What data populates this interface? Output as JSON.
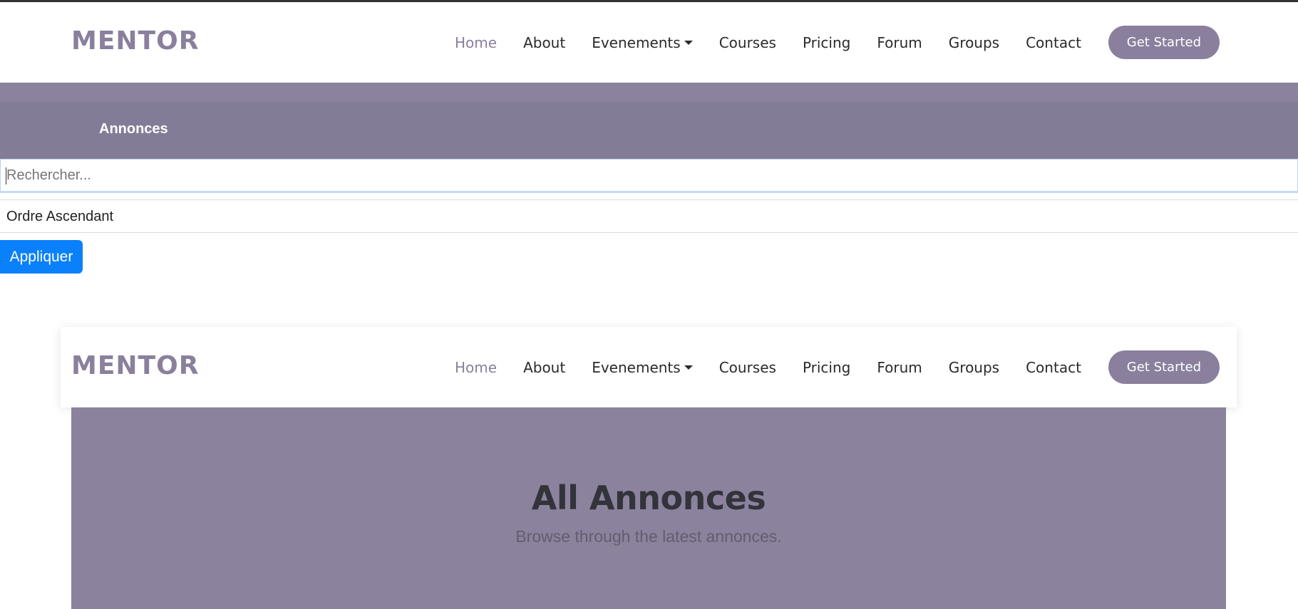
{
  "brand": {
    "logo": "MENTOR",
    "accent_color": "#8a809d"
  },
  "nav": {
    "items": [
      {
        "label": "Home",
        "active": true
      },
      {
        "label": "About"
      },
      {
        "label": "Evenements",
        "dropdown": true
      },
      {
        "label": "Courses"
      },
      {
        "label": "Pricing"
      },
      {
        "label": "Forum"
      },
      {
        "label": "Groups"
      },
      {
        "label": "Contact"
      }
    ],
    "cta_label": "Get Started"
  },
  "breadcrumb": {
    "title": "Annonces"
  },
  "filters": {
    "search_placeholder": "Rechercher...",
    "sort_value": "Ordre Ascendant",
    "apply_label": "Appliquer",
    "apply_color": "#0a80fb"
  },
  "hero": {
    "title": "All Annonces",
    "subtitle": "Browse through the latest annonces.",
    "background_color": "#8b829e"
  }
}
